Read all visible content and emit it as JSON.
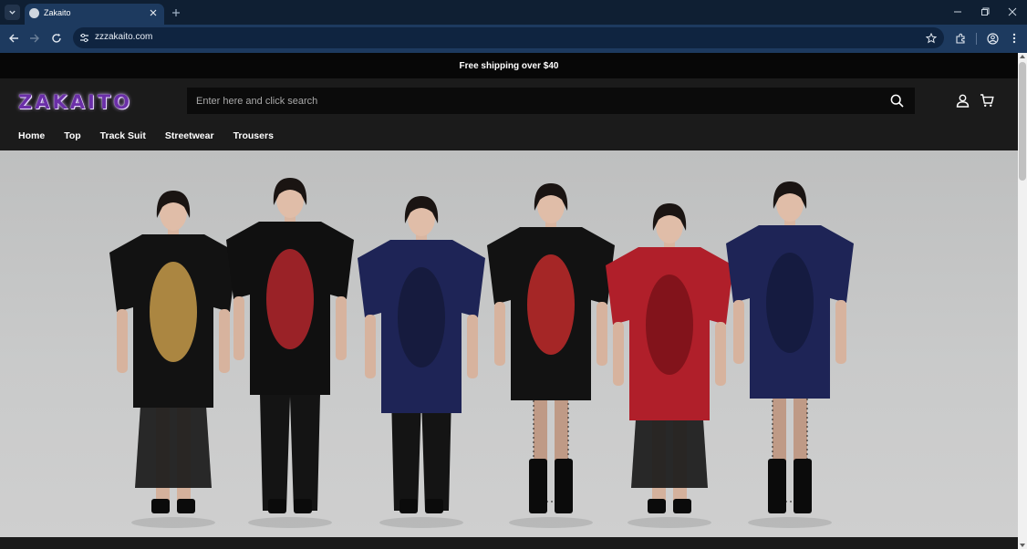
{
  "browser": {
    "tab_title": "Zakaito",
    "url": "zzzakaito.com",
    "accent": "#1d3a5f",
    "icons": [
      "tab-search-icon",
      "favicon-icon",
      "close-icon",
      "plus-icon",
      "minimize-icon",
      "restore-icon",
      "window-close-icon",
      "back-icon",
      "forward-icon",
      "reload-icon",
      "site-info-icon",
      "star-icon",
      "extensions-icon",
      "profile-icon",
      "kebab-menu-icon"
    ]
  },
  "announcement": {
    "text": "Free shipping over $40"
  },
  "header": {
    "logo_text": "ZAKAITO",
    "logo_color": "#6b2fa8",
    "search": {
      "placeholder": "Enter here and click search",
      "value": ""
    },
    "icons": [
      "search-icon",
      "account-icon",
      "cart-icon"
    ]
  },
  "nav": {
    "items": [
      {
        "label": "Home"
      },
      {
        "label": "Top"
      },
      {
        "label": "Track Suit"
      },
      {
        "label": "Streetwear"
      },
      {
        "label": "Trousers"
      }
    ]
  },
  "hero": {
    "models": [
      {
        "shirt": "#121212",
        "print": "#c79b4a",
        "bottom": "lace-skirt",
        "legs": "bare",
        "shoes": "black"
      },
      {
        "shirt": "#101010",
        "print": "#b3262b",
        "bottom": "pants",
        "legs": "pants",
        "shoes": "black"
      },
      {
        "shirt": "#1e2456",
        "print": "#151a3a",
        "bottom": "pants",
        "legs": "pants",
        "shoes": "black"
      },
      {
        "shirt": "#121212",
        "print": "#c02a2a",
        "bottom": "dress",
        "legs": "fishnet",
        "shoes": "boots"
      },
      {
        "shirt": "#b01f2a",
        "print": "#7a1219",
        "bottom": "lace-skirt",
        "legs": "bare",
        "shoes": "black"
      },
      {
        "shirt": "#1e2456",
        "print": "#141a3c",
        "bottom": "shorts",
        "legs": "fishnet",
        "shoes": "boots"
      }
    ]
  }
}
